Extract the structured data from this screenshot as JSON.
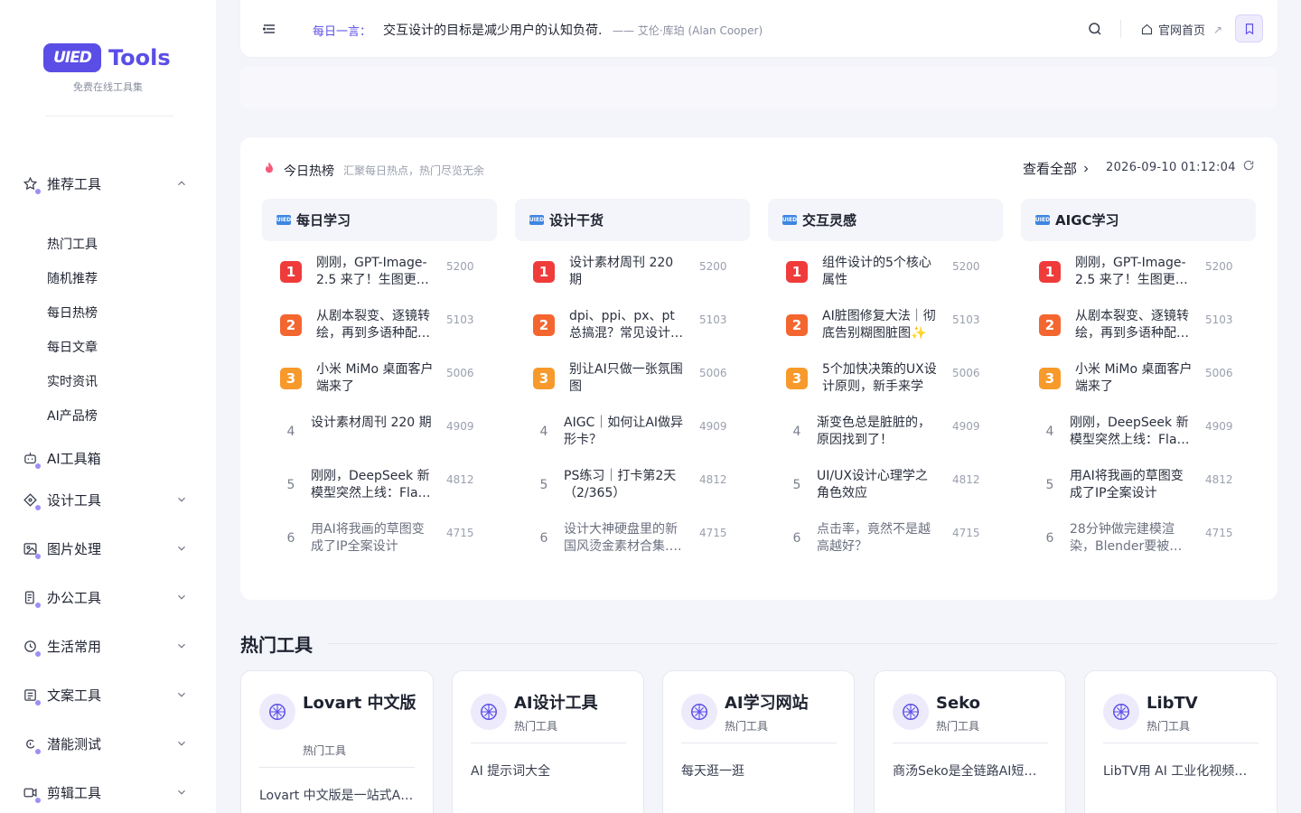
{
  "sidebar": {
    "logo_badge": "UIED",
    "logo_text": "Tools",
    "logo_sub": "免费在线工具集",
    "recommended": {
      "label": "推荐工具",
      "icon": "star-icon",
      "children": [
        "热门工具",
        "随机推荐",
        "每日热榜",
        "每日文章",
        "实时资讯",
        "AI产品榜"
      ]
    },
    "items": [
      {
        "label": "AI工具箱",
        "icon": "robot-icon"
      },
      {
        "label": "设计工具",
        "icon": "design-icon"
      },
      {
        "label": "图片处理",
        "icon": "image-icon"
      },
      {
        "label": "办公工具",
        "icon": "office-icon"
      },
      {
        "label": "生活常用",
        "icon": "clock-icon"
      },
      {
        "label": "文案工具",
        "icon": "document-icon"
      },
      {
        "label": "潜能测试",
        "icon": "brain-icon"
      },
      {
        "label": "剪辑工具",
        "icon": "video-icon"
      }
    ]
  },
  "topbar": {
    "quote_label": "每日一言：",
    "quote_text": "交互设计的目标是减少用户的认知负荷.",
    "quote_author": "—— 艾伦·库珀 (Alan Cooper)",
    "home_label": "官网首页",
    "home_arrow": "↗"
  },
  "hot": {
    "title": "今日热榜",
    "subtitle": "汇聚每日热点，热门尽览无余",
    "view_all": "查看全部",
    "time": "2026-09-10 01:12:04",
    "columns": [
      {
        "name": "每日学习",
        "items": [
          {
            "rank": "1",
            "title": "刚刚，GPT-Image-2.5 来了！生图更…",
            "count": "5200"
          },
          {
            "rank": "2",
            "title": "从剧本裂变、逐镜转绘，再到多语种配…",
            "count": "5103"
          },
          {
            "rank": "3",
            "title": "小米 MiMo 桌面客户端来了",
            "count": "5006"
          },
          {
            "rank": "4",
            "title": "设计素材周刊 220 期",
            "count": "4909"
          },
          {
            "rank": "5",
            "title": "刚刚，DeepSeek 新模型突然上线：Fla…",
            "count": "4812"
          },
          {
            "rank": "6",
            "title": "用AI将我画的草图变成了IP全案设计",
            "count": "4715"
          }
        ]
      },
      {
        "name": "设计干货",
        "items": [
          {
            "rank": "1",
            "title": "设计素材周刊 220 期",
            "count": "5200"
          },
          {
            "rank": "2",
            "title": "dpi、ppi、px、pt 总搞混？常见设计…",
            "count": "5103"
          },
          {
            "rank": "3",
            "title": "别让AI只做一张氛围图",
            "count": "5006"
          },
          {
            "rank": "4",
            "title": "AIGC｜如何让AI做异形卡？",
            "count": "4909"
          },
          {
            "rank": "5",
            "title": "PS练习｜打卡第2天（2/365）",
            "count": "4812"
          },
          {
            "rank": "6",
            "title": "设计大神硬盘里的新国风烫金素材合集….",
            "count": "4715"
          }
        ]
      },
      {
        "name": "交互灵感",
        "items": [
          {
            "rank": "1",
            "title": "组件设计的5个核心属性",
            "count": "5200"
          },
          {
            "rank": "2",
            "title": "AI脏图修复大法｜彻底告别糊图脏图✨",
            "count": "5103"
          },
          {
            "rank": "3",
            "title": "5个加快决策的UX设计原则，新手来学",
            "count": "5006"
          },
          {
            "rank": "4",
            "title": "渐变色总是脏脏的，原因找到了！",
            "count": "4909"
          },
          {
            "rank": "5",
            "title": "UI/UX设计心理学之角色效应",
            "count": "4812"
          },
          {
            "rank": "6",
            "title": "点击率，竟然不是越高越好？",
            "count": "4715"
          }
        ]
      },
      {
        "name": "AIGC学习",
        "items": [
          {
            "rank": "1",
            "title": "刚刚，GPT-Image-2.5 来了！生图更…",
            "count": "5200"
          },
          {
            "rank": "2",
            "title": "从剧本裂变、逐镜转绘，再到多语种配…",
            "count": "5103"
          },
          {
            "rank": "3",
            "title": "小米 MiMo 桌面客户端来了",
            "count": "5006"
          },
          {
            "rank": "4",
            "title": "刚刚，DeepSeek 新模型突然上线：Fla…",
            "count": "4909"
          },
          {
            "rank": "5",
            "title": "用AI将我画的草图变成了IP全案设计",
            "count": "4812"
          },
          {
            "rank": "6",
            "title": "28分钟做完建模渲染，Blender要被…",
            "count": "4715"
          }
        ]
      }
    ]
  },
  "tools": {
    "section_title": "热门工具",
    "cards": [
      {
        "title": "Lovart 中文版",
        "tag": "热门工具",
        "desc": "Lovart 中文版是一站式A…"
      },
      {
        "title": "AI设计工具",
        "tag": "热门工具",
        "desc": "AI 提示词大全"
      },
      {
        "title": "AI学习网站",
        "tag": "热门工具",
        "desc": "每天逛一逛"
      },
      {
        "title": "Seko",
        "tag": "热门工具",
        "desc": "商汤Seko是全链路AI短…"
      },
      {
        "title": "LibTV",
        "tag": "热门工具",
        "desc": "LibTV用 AI 工业化视频…"
      }
    ]
  },
  "colors": {
    "accent": "#5b4ee6",
    "rank1": "#f03b3b",
    "rank2": "#f4662f",
    "rank3": "#f79a2b"
  }
}
